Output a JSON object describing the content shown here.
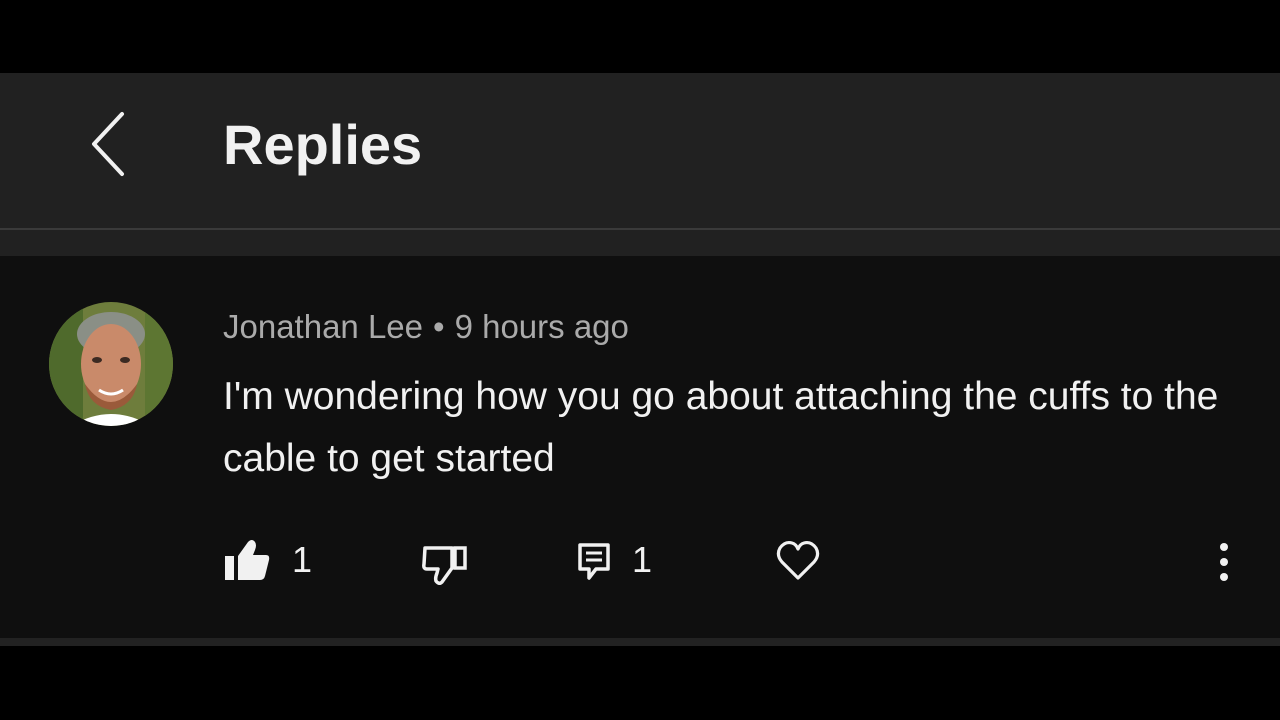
{
  "header": {
    "title": "Replies",
    "back_icon": "chevron-left-icon"
  },
  "comment": {
    "author": "Jonathan Lee",
    "separator": "•",
    "time": "9 hours ago",
    "text": "I'm wondering how you go about attaching the cuffs to the cable to get started",
    "likes": "1",
    "replies": "1"
  },
  "icons": {
    "like": "thumbs-up-icon",
    "dislike": "thumbs-down-icon",
    "reply": "comment-icon",
    "heart": "heart-icon",
    "more": "more-vertical-icon"
  },
  "colors": {
    "background": "#0f0f0f",
    "header": "#212121",
    "text": "#f1f1f1",
    "muted": "#aaaaaa"
  }
}
